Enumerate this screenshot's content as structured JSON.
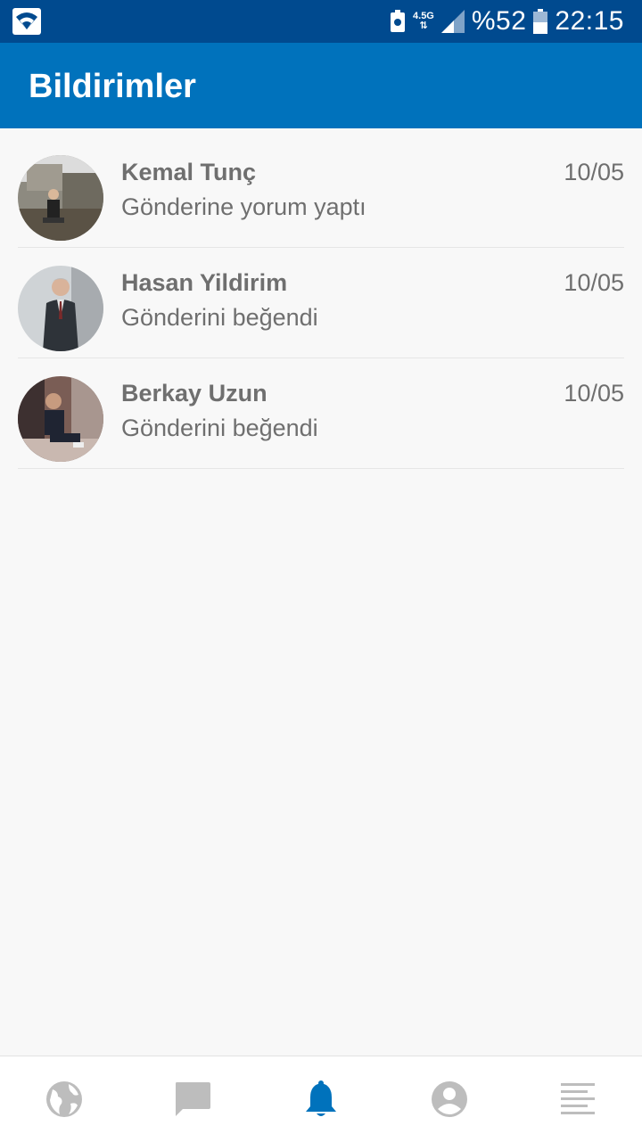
{
  "status_bar": {
    "network": "4.5G",
    "battery_percent": "%52",
    "time": "22:15"
  },
  "app_bar": {
    "title": "Bildirimler"
  },
  "notifications": [
    {
      "name": "Kemal Tunç",
      "message": "Gönderine yorum yaptı",
      "date": "10/05"
    },
    {
      "name": "Hasan Yildirim",
      "message": "Gönderini beğendi",
      "date": "10/05"
    },
    {
      "name": "Berkay Uzun",
      "message": "Gönderini beğendi",
      "date": "10/05"
    }
  ],
  "bottom_nav": {
    "items": [
      {
        "icon": "globe-icon"
      },
      {
        "icon": "chat-icon"
      },
      {
        "icon": "bell-icon",
        "active": true
      },
      {
        "icon": "account-icon"
      },
      {
        "icon": "menu-lines-icon"
      }
    ],
    "active_color": "#0072bc",
    "inactive_color": "#bdbdbd"
  },
  "colors": {
    "status_bar": "#004a8f",
    "app_bar": "#0072bc",
    "background": "#f8f8f8"
  }
}
